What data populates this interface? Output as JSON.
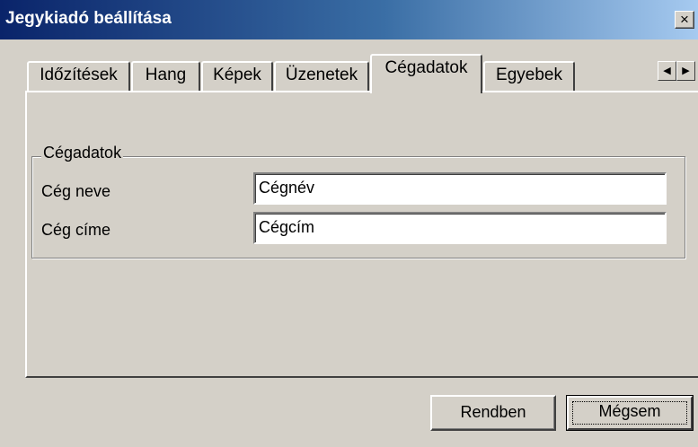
{
  "window": {
    "title": "Jegykiadó beállítása",
    "close_label": "×"
  },
  "tabs": [
    {
      "label": "Időzítések"
    },
    {
      "label": "Hang"
    },
    {
      "label": "Képek"
    },
    {
      "label": "Üzenetek"
    },
    {
      "label": "Cégadatok",
      "active": true
    },
    {
      "label": "Egyebek"
    }
  ],
  "tab_scroll": {
    "left_icon": "◀",
    "right_icon": "▶"
  },
  "group": {
    "title": "Cégadatok",
    "fields": [
      {
        "label": "Cég neve",
        "value": "Cégnév"
      },
      {
        "label": "Cég címe",
        "value": "Cégcím"
      }
    ]
  },
  "buttons": {
    "ok_label": "Rendben",
    "cancel_label": "Mégsem"
  }
}
